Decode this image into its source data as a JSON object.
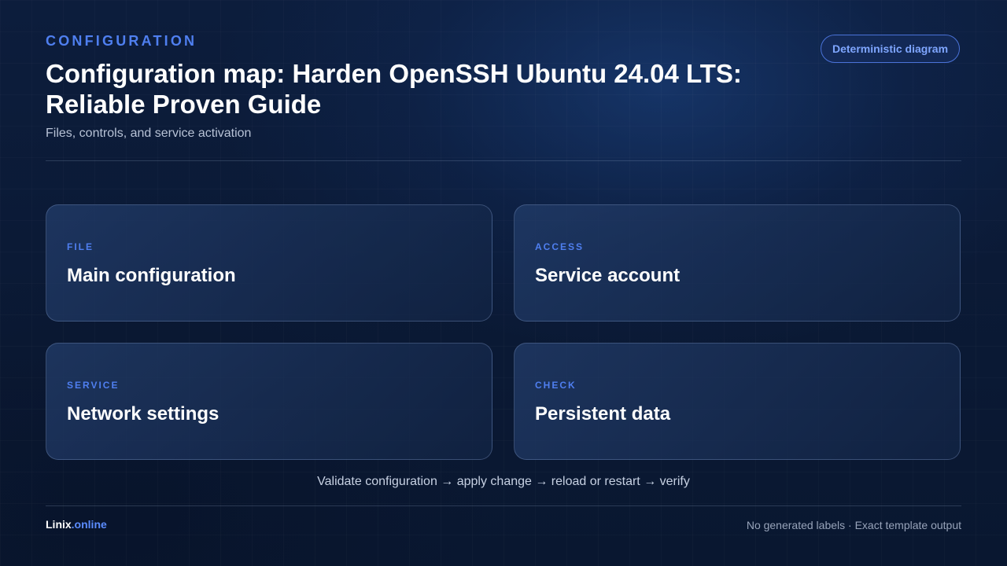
{
  "header": {
    "eyebrow": "CONFIGURATION",
    "title": "Configuration map: Harden OpenSSH Ubuntu 24.04 LTS: Reliable Proven Guide",
    "subtitle": "Files, controls, and service activation",
    "badge": "Deterministic diagram"
  },
  "cards": [
    {
      "kicker": "FILE",
      "label": "Main configuration"
    },
    {
      "kicker": "ACCESS",
      "label": "Service account"
    },
    {
      "kicker": "SERVICE",
      "label": "Network settings"
    },
    {
      "kicker": "CHECK",
      "label": "Persistent data"
    }
  ],
  "flow": "Validate configuration → apply change → reload or restart → verify",
  "footer": {
    "brand_name": "Linix",
    "brand_tld": ".online",
    "note": "No generated labels · Exact template output"
  },
  "colors": {
    "accent": "#4f7ff0",
    "background": "#0b1a36",
    "card_border": "#8ca5d2",
    "text": "#ffffff"
  }
}
